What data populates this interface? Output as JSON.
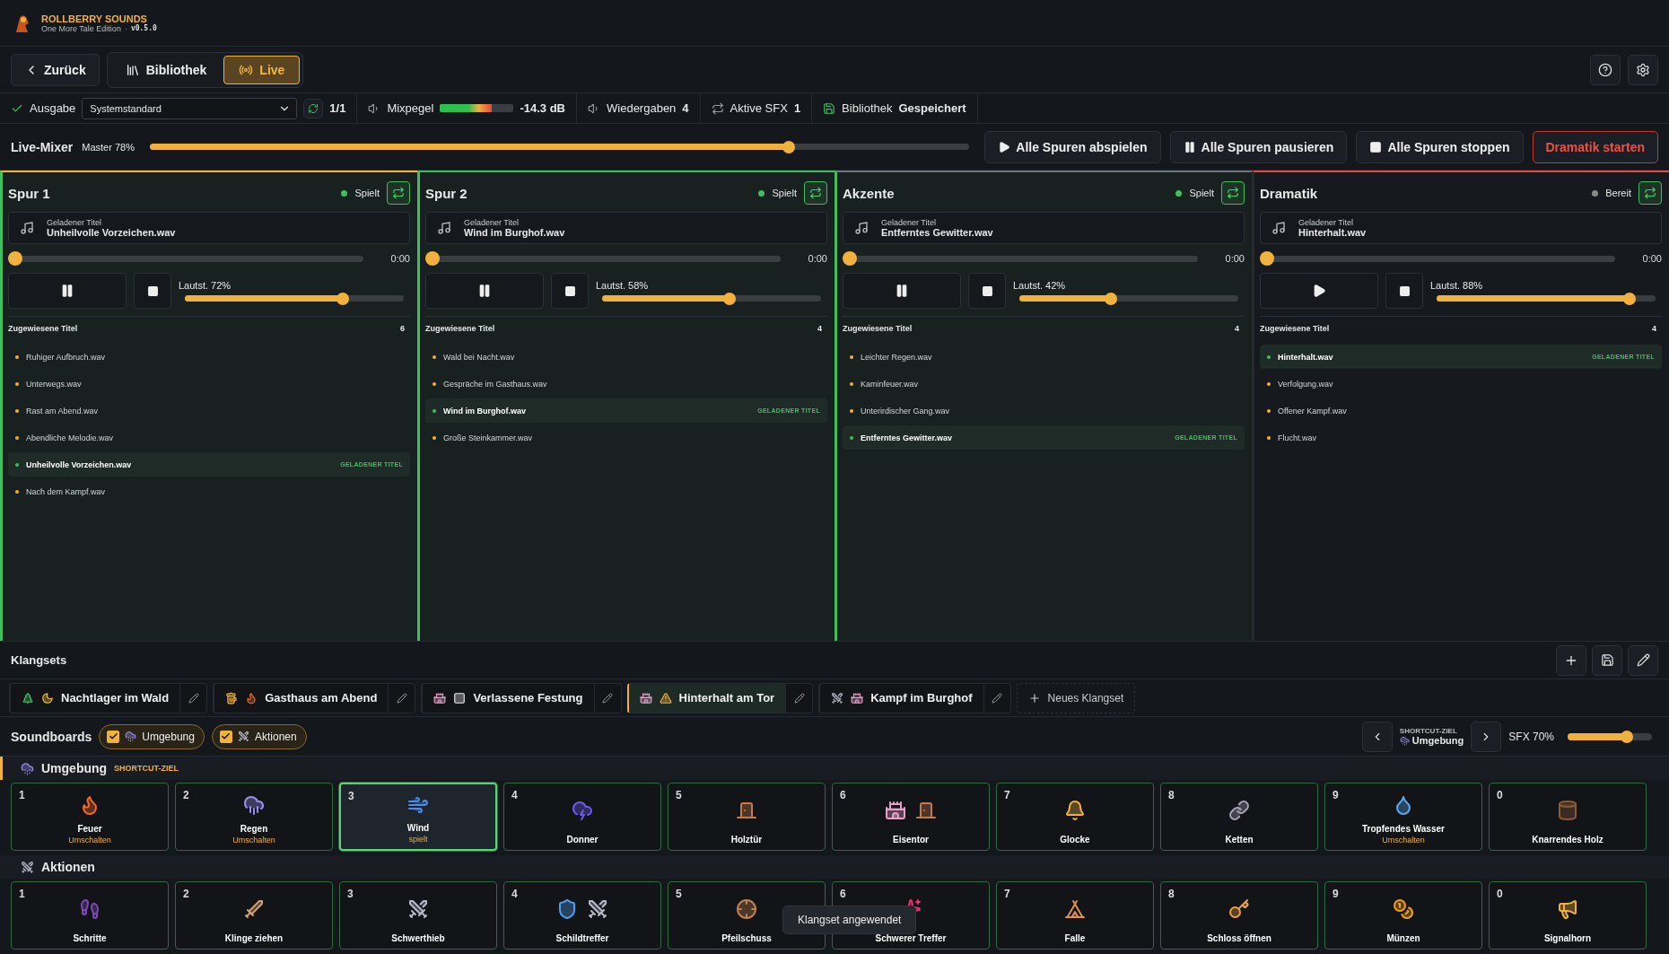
{
  "app": {
    "title": "ROLLBERRY SOUNDS",
    "edition": "One More Tale Edition",
    "separator": "·",
    "version": "v0.5.0"
  },
  "nav": {
    "back": "Zurück",
    "tabs": [
      {
        "label": "Bibliothek",
        "selected": false
      },
      {
        "label": "Live",
        "selected": true
      }
    ]
  },
  "status_bar": {
    "output_label": "Ausgabe",
    "output_device": "Systemstandard",
    "device_count": "1/1",
    "mix_label": "Mixpegel",
    "mix_meter": {
      "level": 0.7
    },
    "mix_reading": "-14.3 dB",
    "playbacks_label": "Wiedergaben",
    "playbacks": "4",
    "sfx_label": "Aktive SFX",
    "sfx": "1",
    "library_label": "Bibliothek",
    "library_state": "Gespeichert"
  },
  "mixer": {
    "title": "Live-Mixer",
    "master_label": "Master 78%",
    "master": {
      "level": 0.78
    },
    "buttons": [
      {
        "label": "Alle Spuren abspielen",
        "kind": "play"
      },
      {
        "label": "Alle Spuren pausieren",
        "kind": "pause"
      },
      {
        "label": "Alle Spuren stoppen",
        "kind": "stop"
      },
      {
        "label": "Dramatik starten",
        "kind": "danger"
      }
    ]
  },
  "tracks": [
    {
      "name": "Spur 1",
      "color": "#f0b13e",
      "status": "Spielt",
      "playing": true,
      "loaded_label": "Geladener Titel",
      "loaded": "Unheilvolle Vorzeichen.wav",
      "position": {
        "level": 0
      },
      "time": "0:00",
      "volume_label": "Lautst. 72%",
      "volume": {
        "level": 0.72
      },
      "list_title": "Zugewiesene Titel",
      "count": "6",
      "items": [
        {
          "label": "Ruhiger Aufbruch.wav",
          "selected": false
        },
        {
          "label": "Unterwegs.wav",
          "selected": false
        },
        {
          "label": "Rast am Abend.wav",
          "selected": false
        },
        {
          "label": "Abendliche Melodie.wav",
          "selected": false
        },
        {
          "label": "Unheilvolle Vorzeichen.wav",
          "selected": true,
          "badge": "GELADENER TITEL"
        },
        {
          "label": "Nach dem Kampf.wav",
          "selected": false
        }
      ]
    },
    {
      "name": "Spur 2",
      "color": "#3fbf5f",
      "status": "Spielt",
      "playing": true,
      "loaded_label": "Geladener Titel",
      "loaded": "Wind im Burghof.wav",
      "position": {
        "level": 0
      },
      "time": "0:00",
      "volume_label": "Lautst. 58%",
      "volume": {
        "level": 0.58
      },
      "list_title": "Zugewiesene Titel",
      "count": "4",
      "items": [
        {
          "label": "Wald bei Nacht.wav",
          "selected": false
        },
        {
          "label": "Gespräche im Gasthaus.wav",
          "selected": false
        },
        {
          "label": "Wind im Burghof.wav",
          "selected": true,
          "badge": "GELADENER TITEL"
        },
        {
          "label": "Große Steinkammer.wav",
          "selected": false
        }
      ]
    },
    {
      "name": "Akzente",
      "color": "#6b7280",
      "status": "Spielt",
      "playing": true,
      "loaded_label": "Geladener Titel",
      "loaded": "Entferntes Gewitter.wav",
      "position": {
        "level": 0
      },
      "time": "0:00",
      "volume_label": "Lautst. 42%",
      "volume": {
        "level": 0.42
      },
      "list_title": "Zugewiesene Titel",
      "count": "4",
      "items": [
        {
          "label": "Leichter Regen.wav",
          "selected": false
        },
        {
          "label": "Kaminfeuer.wav",
          "selected": false
        },
        {
          "label": "Unterirdischer Gang.wav",
          "selected": false
        },
        {
          "label": "Entferntes Gewitter.wav",
          "selected": true,
          "badge": "GELADENER TITEL"
        }
      ]
    },
    {
      "name": "Dramatik",
      "color": "#e5483f",
      "status": "Bereit",
      "playing": false,
      "loaded_label": "Geladener Titel",
      "loaded": "Hinterhalt.wav",
      "position": {
        "level": 0
      },
      "time": "0:00",
      "volume_label": "Lautst. 88%",
      "volume": {
        "level": 0.88
      },
      "list_title": "Zugewiesene Titel",
      "count": "4",
      "items": [
        {
          "label": "Hinterhalt.wav",
          "selected": true,
          "badge": "GELADENER TITEL"
        },
        {
          "label": "Verfolgung.wav",
          "selected": false
        },
        {
          "label": "Offener Kampf.wav",
          "selected": false
        },
        {
          "label": "Flucht.wav",
          "selected": false
        }
      ]
    }
  ],
  "klangsets": {
    "title": "Klangsets",
    "sets": [
      {
        "label": "Nachtlager im Wald",
        "selected": false
      },
      {
        "label": "Gasthaus am Abend",
        "selected": false
      },
      {
        "label": "Verlassene Festung",
        "selected": false
      },
      {
        "label": "Hinterhalt am Tor",
        "selected": true
      },
      {
        "label": "Kampf im Burghof",
        "selected": false
      }
    ],
    "new_label": "Neues Klangset"
  },
  "soundboards": {
    "title": "Soundboards",
    "filters": [
      {
        "label": "Umgebung",
        "checked": true
      },
      {
        "label": "Aktionen",
        "checked": true
      }
    ],
    "target_caption": "SHORTCUT-ZIEL",
    "target": "Umgebung",
    "sfx_label": "SFX 70%",
    "sfx": {
      "level": 0.7
    }
  },
  "boards": [
    {
      "name": "Umgebung",
      "tag": "SHORTCUT-ZIEL",
      "pads": [
        {
          "key": "1",
          "name": "Feuer",
          "note": "Umschalten",
          "selected": false
        },
        {
          "key": "2",
          "name": "Regen",
          "note": "Umschalten",
          "selected": false
        },
        {
          "key": "3",
          "name": "Wind",
          "note": "spielt",
          "selected": true
        },
        {
          "key": "4",
          "name": "Donner",
          "selected": false
        },
        {
          "key": "5",
          "name": "Holztür",
          "selected": false
        },
        {
          "key": "6",
          "name": "Eisentor",
          "selected": false
        },
        {
          "key": "7",
          "name": "Glocke",
          "selected": false
        },
        {
          "key": "8",
          "name": "Ketten",
          "selected": false
        },
        {
          "key": "9",
          "name": "Tropfendes Wasser",
          "note": "Umschalten",
          "selected": false
        },
        {
          "key": "0",
          "name": "Knarrendes Holz",
          "selected": false
        }
      ]
    },
    {
      "name": "Aktionen",
      "pads": [
        {
          "key": "1",
          "name": "Schritte",
          "selected": false
        },
        {
          "key": "2",
          "name": "Klinge ziehen",
          "selected": false
        },
        {
          "key": "3",
          "name": "Schwerthieb",
          "selected": false
        },
        {
          "key": "4",
          "name": "Schildtreffer",
          "selected": false
        },
        {
          "key": "5",
          "name": "Pfeilschuss",
          "selected": false
        },
        {
          "key": "6",
          "name": "Schwerer Treffer",
          "selected": false
        },
        {
          "key": "7",
          "name": "Falle",
          "selected": false
        },
        {
          "key": "8",
          "name": "Schloss öffnen",
          "selected": false
        },
        {
          "key": "9",
          "name": "Münzen",
          "selected": false
        },
        {
          "key": "0",
          "name": "Signalhorn",
          "selected": false
        }
      ]
    }
  ],
  "toast": "Klangset angewendet"
}
